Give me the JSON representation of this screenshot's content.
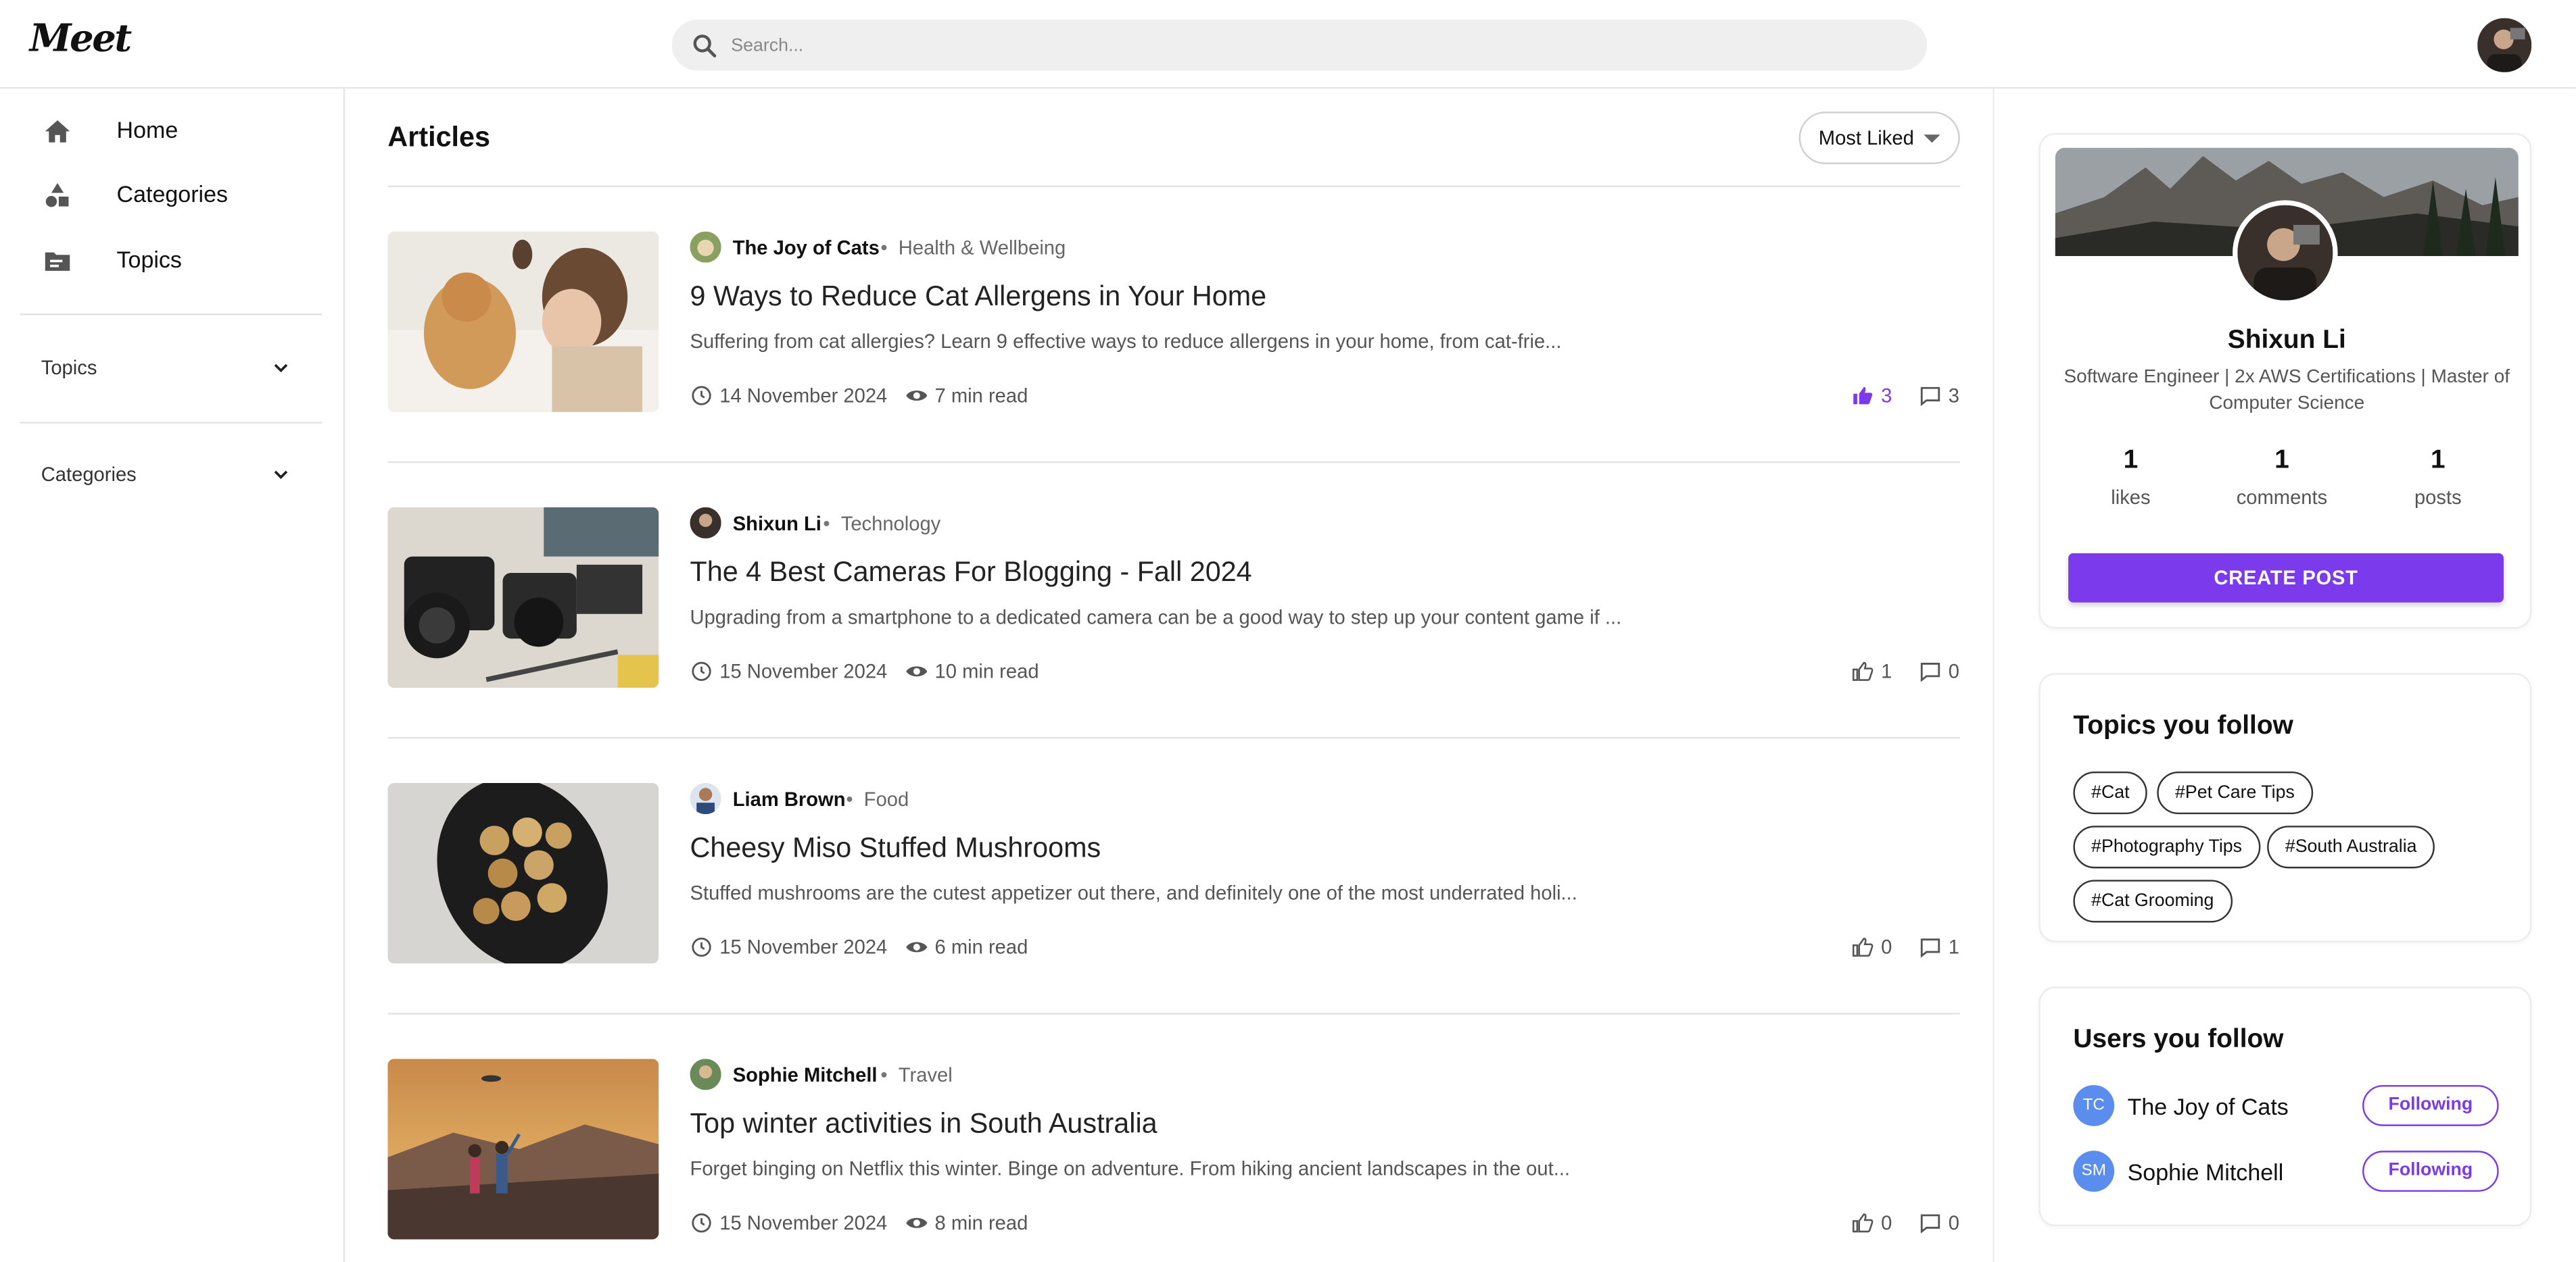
{
  "app": {
    "logo_text": "Meet"
  },
  "search": {
    "placeholder": "Search..."
  },
  "sidebar": {
    "nav": [
      {
        "label": "Home",
        "icon": "home-icon"
      },
      {
        "label": "Categories",
        "icon": "shapes-icon"
      },
      {
        "label": "Topics",
        "icon": "folder-icon"
      }
    ],
    "sections": [
      {
        "label": "Topics"
      },
      {
        "label": "Categories"
      }
    ]
  },
  "articles": {
    "heading": "Articles",
    "sort_label": "Most Liked",
    "items": [
      {
        "author": "The Joy of Cats",
        "category": "Health & Wellbeing",
        "title": "9 Ways to Reduce Cat Allergens in Your Home",
        "excerpt": "Suffering from cat allergies? Learn 9 effective ways to reduce allergens in your home, from cat-frie...",
        "date": "14 November 2024",
        "read_time": "7 min read",
        "likes": "3",
        "comments": "3",
        "liked": true
      },
      {
        "author": "Shixun Li",
        "category": "Technology",
        "title": "The 4 Best Cameras For Blogging - Fall 2024",
        "excerpt": "Upgrading from a smartphone to a dedicated camera can be a good way to step up your content game if ...",
        "date": "15 November 2024",
        "read_time": "10 min read",
        "likes": "1",
        "comments": "0",
        "liked": false
      },
      {
        "author": "Liam Brown",
        "category": "Food",
        "title": "Cheesy Miso Stuffed Mushrooms",
        "excerpt": "Stuffed mushrooms are the cutest appetizer out there, and definitely one of the most underrated holi...",
        "date": "15 November 2024",
        "read_time": "6 min read",
        "likes": "0",
        "comments": "1",
        "liked": false
      },
      {
        "author": "Sophie Mitchell",
        "category": "Travel",
        "title": "Top winter activities in South Australia",
        "excerpt": "Forget binging on Netflix this winter. Binge on adventure. From hiking ancient landscapes in the out...",
        "date": "15 November 2024",
        "read_time": "8 min read",
        "likes": "0",
        "comments": "0",
        "liked": false
      }
    ]
  },
  "profile": {
    "name": "Shixun Li",
    "bio": "Software Engineer | 2x AWS Certifications | Master of Computer Science",
    "stats": [
      {
        "value": "1",
        "label": "likes"
      },
      {
        "value": "1",
        "label": "comments"
      },
      {
        "value": "1",
        "label": "posts"
      }
    ],
    "create_button": "CREATE POST"
  },
  "topics_follow": {
    "title": "Topics you follow",
    "tags": [
      "#Cat",
      "#Pet Care Tips",
      "#Photography Tips",
      "#South Australia",
      "#Cat Grooming"
    ]
  },
  "users_follow": {
    "title": "Users you follow",
    "users": [
      {
        "initials": "TC",
        "name": "The Joy of Cats",
        "button": "Following"
      },
      {
        "initials": "SM",
        "name": "Sophie Mitchell",
        "button": "Following"
      }
    ]
  },
  "colors": {
    "accent": "#7c3aed",
    "avatar_blue": "#5b8def"
  }
}
